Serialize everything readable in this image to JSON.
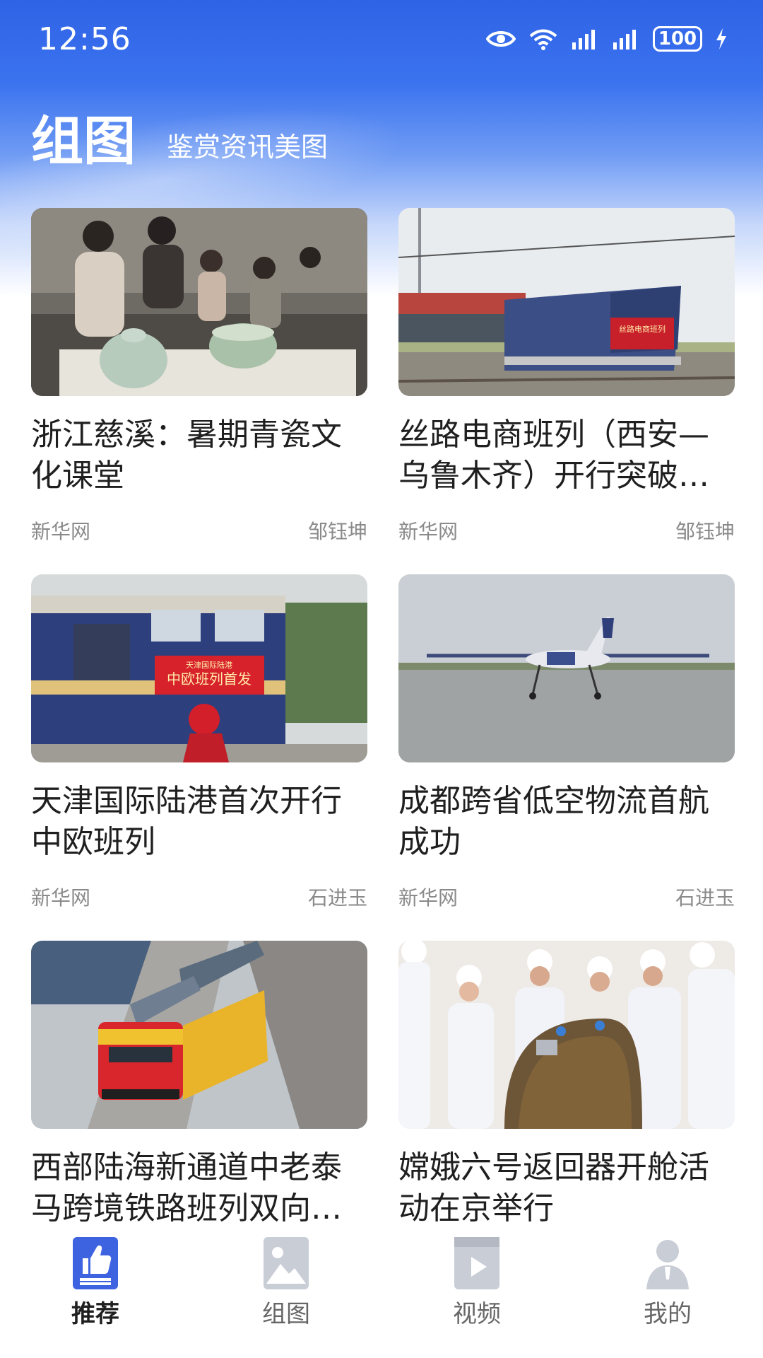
{
  "status_bar": {
    "time": "12:56",
    "battery": "100"
  },
  "header": {
    "title": "组图",
    "subtitle": "鉴赏资讯美图"
  },
  "cards": [
    {
      "title": "浙江慈溪：暑期青瓷文化课堂",
      "source": "新华网",
      "author": "邹钰坤"
    },
    {
      "title": "丝路电商班列（西安—乌鲁木齐）开行突破…",
      "source": "新华网",
      "author": "邹钰坤",
      "banner": "丝路电商班列"
    },
    {
      "title": "天津国际陆港首次开行中欧班列",
      "source": "新华网",
      "author": "石进玉",
      "banner_top": "天津国际陆港",
      "banner": "中欧班列首发"
    },
    {
      "title": "成都跨省低空物流首航成功",
      "source": "新华网",
      "author": "石进玉"
    },
    {
      "title": "西部陆海新通道中老泰马跨境铁路班列双向…",
      "source": "",
      "author": ""
    },
    {
      "title": "嫦娥六号返回器开舱活动在京举行",
      "source": "",
      "author": ""
    }
  ],
  "bottom_nav": [
    {
      "label": "推荐",
      "icon": "thumbs-up-icon",
      "active": true
    },
    {
      "label": "组图",
      "icon": "image-icon",
      "active": false
    },
    {
      "label": "视频",
      "icon": "video-icon",
      "active": false
    },
    {
      "label": "我的",
      "icon": "user-icon",
      "active": false
    }
  ],
  "colors": {
    "brand": "#2f63e6",
    "active_nav": "#3e63e0",
    "inactive_nav": "#c9cdd6"
  }
}
